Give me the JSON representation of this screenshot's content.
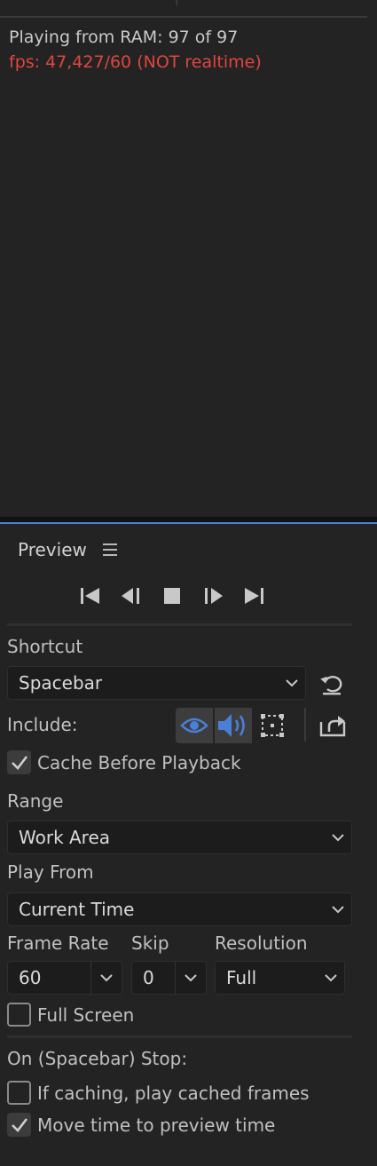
{
  "colors": {
    "accent": "#4a7fd8",
    "warning": "#e0453f"
  },
  "info": {
    "ram_status": "Playing from RAM: 97 of 97",
    "fps_status": "fps: 47,427/60 (NOT realtime)"
  },
  "preview": {
    "title": "Preview",
    "transport": [
      {
        "name": "first-frame-icon"
      },
      {
        "name": "previous-frame-icon"
      },
      {
        "name": "stop-icon"
      },
      {
        "name": "next-frame-icon"
      },
      {
        "name": "last-frame-icon"
      }
    ],
    "shortcut": {
      "label": "Shortcut",
      "value": "Spacebar",
      "reset_icon": "reset-icon"
    },
    "include": {
      "label": "Include:",
      "video": {
        "icon": "eye-icon",
        "on": true
      },
      "audio": {
        "icon": "speaker-icon",
        "on": true
      },
      "overlays": {
        "icon": "overlay-frame-icon",
        "on": false
      },
      "export_icon": "export-icon"
    },
    "cache_before_playback": {
      "label": "Cache Before Playback",
      "checked": true
    },
    "range": {
      "label": "Range",
      "value": "Work Area"
    },
    "play_from": {
      "label": "Play From",
      "value": "Current Time"
    },
    "frame_rate": {
      "label": "Frame Rate",
      "value": "60"
    },
    "skip": {
      "label": "Skip",
      "value": "0"
    },
    "resolution": {
      "label": "Resolution",
      "value": "Full"
    },
    "full_screen": {
      "label": "Full Screen",
      "checked": false
    },
    "on_stop": {
      "label": "On (Spacebar) Stop:",
      "play_cached": {
        "label": "If caching, play cached frames",
        "checked": false
      },
      "move_time": {
        "label": "Move time to preview time",
        "checked": true
      }
    }
  }
}
